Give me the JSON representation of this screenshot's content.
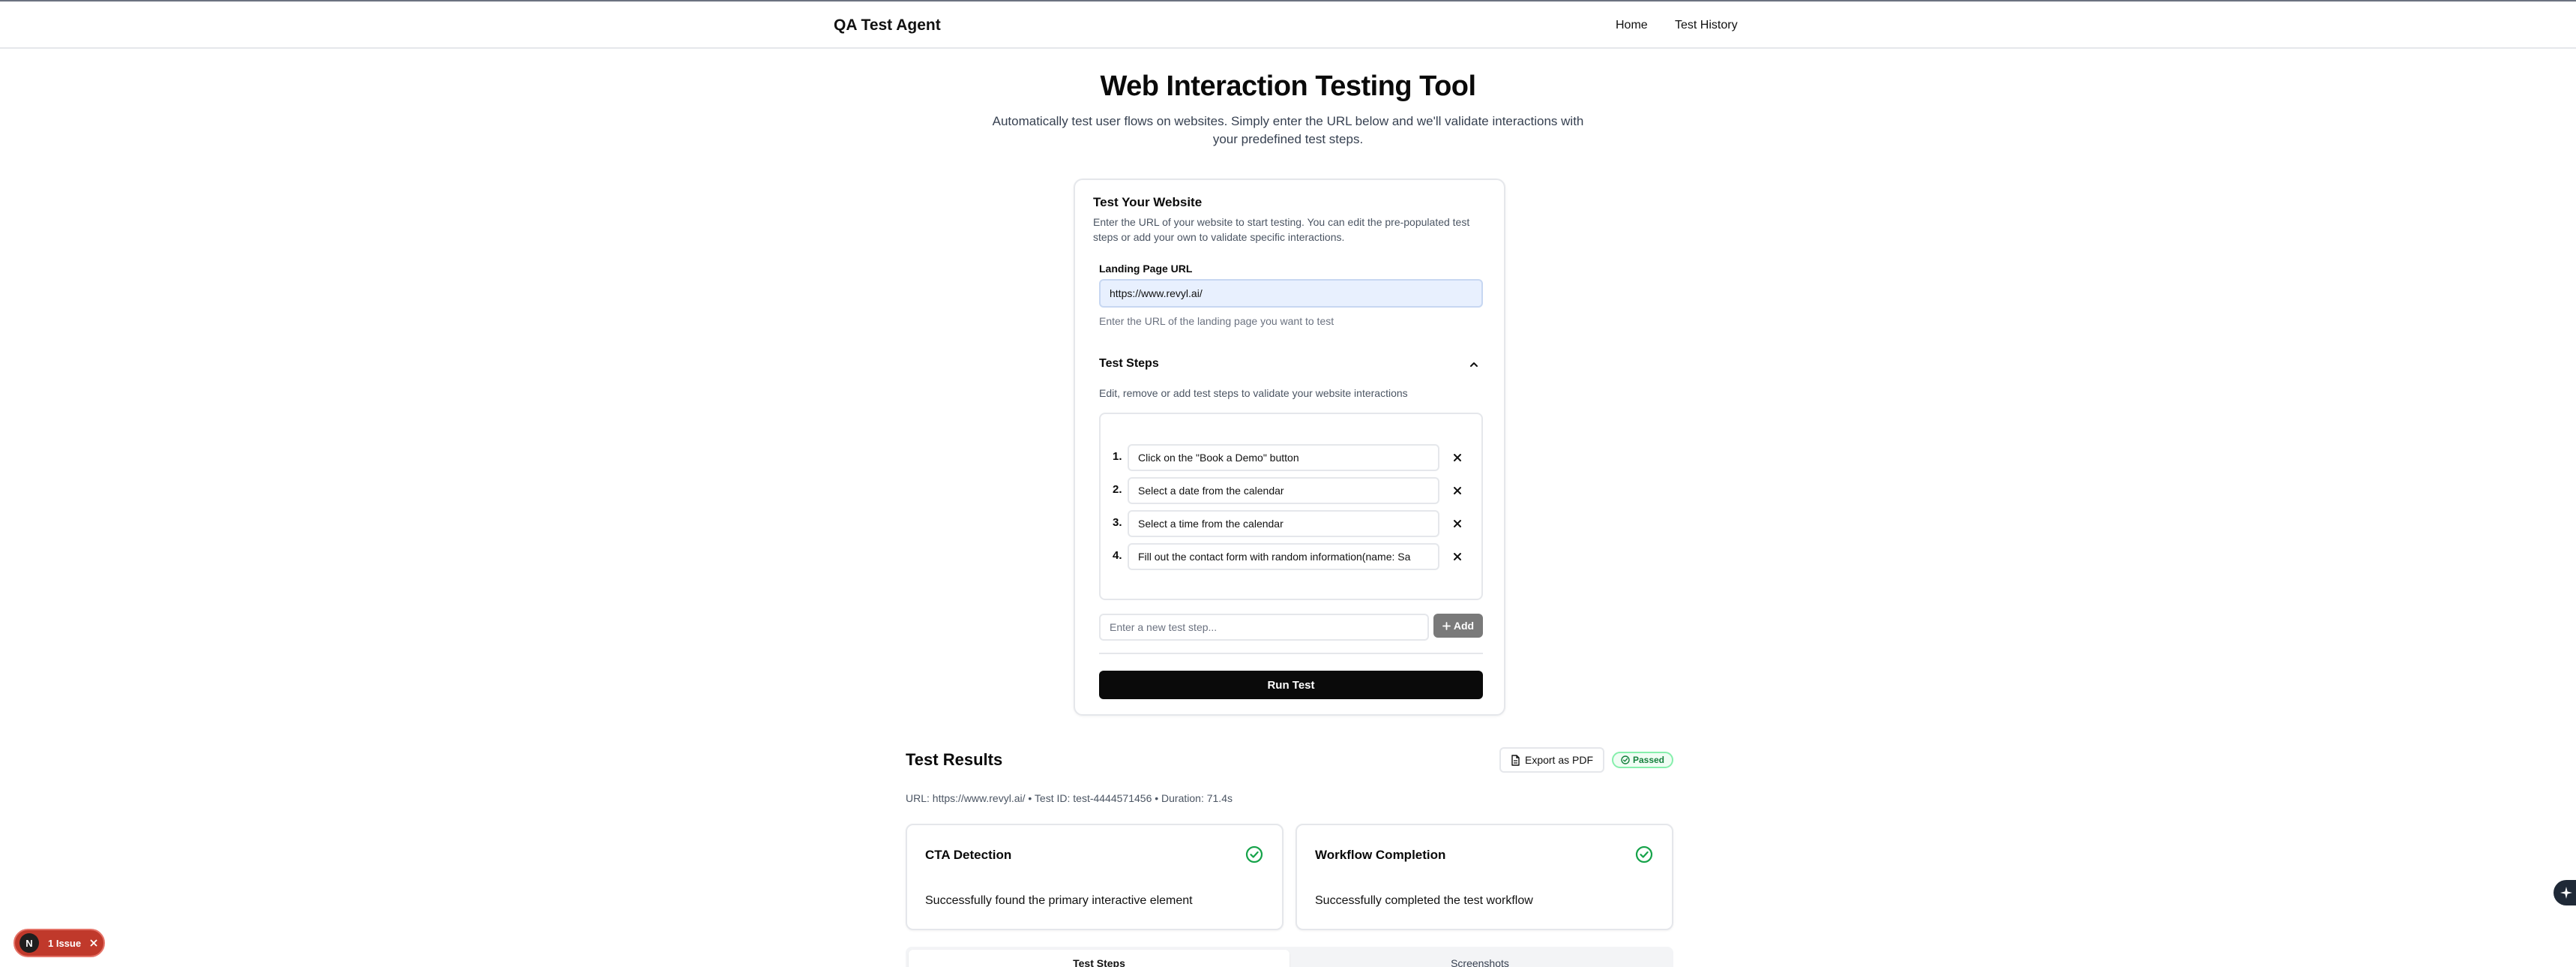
{
  "header": {
    "brand": "QA Test Agent",
    "nav": [
      {
        "label": "Home"
      },
      {
        "label": "Test History"
      }
    ]
  },
  "hero": {
    "title": "Web Interaction Testing Tool",
    "subtitle": "Automatically test user flows on websites. Simply enter the URL below and we'll validate interactions with your predefined test steps."
  },
  "form": {
    "title": "Test Your Website",
    "description": "Enter the URL of your website to start testing. You can edit the pre-populated test steps or add your own to validate specific interactions.",
    "url_label": "Landing Page URL",
    "url_value": "https://www.revyl.ai/",
    "url_help": "Enter the URL of the landing page you want to test",
    "steps_title": "Test Steps",
    "steps_description": "Edit, remove or add test steps to validate your website interactions",
    "steps": [
      {
        "num": "1.",
        "value": "Click on the \"Book a Demo\" button"
      },
      {
        "num": "2.",
        "value": "Select a date from the calendar"
      },
      {
        "num": "3.",
        "value": "Select a time from the calendar"
      },
      {
        "num": "4.",
        "value": "Fill out the contact form with random information(name: Sa"
      }
    ],
    "new_step_placeholder": "Enter a new test step...",
    "add_label": "Add",
    "run_label": "Run Test"
  },
  "results": {
    "title": "Test Results",
    "export_label": "Export as PDF",
    "status": "Passed",
    "meta": "URL: https://www.revyl.ai/ • Test ID: test-4444571456 • Duration: 71.4s",
    "cards": [
      {
        "title": "CTA Detection",
        "text": "Successfully found the primary interactive element"
      },
      {
        "title": "Workflow Completion",
        "text": "Successfully completed the test workflow"
      }
    ],
    "tabs": [
      {
        "label": "Test Steps"
      },
      {
        "label": "Screenshots"
      }
    ]
  },
  "issue_badge": {
    "avatar": "N",
    "label": "1 Issue"
  },
  "colors": {
    "primary": "#0a0a0a",
    "success": "#16a34a",
    "issue": "#c0392b",
    "input_autofill": "#e8f0fe"
  }
}
